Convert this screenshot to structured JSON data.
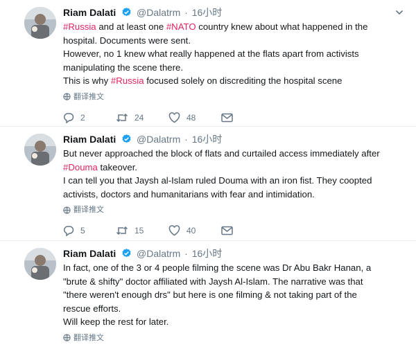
{
  "tweets": [
    {
      "author": "Riam Dalati",
      "handle": "@Dalatrm",
      "time": "16小时",
      "lines": [
        [
          "#Russia",
          " and at least one ",
          "#NATO",
          " country knew about what happened in the"
        ],
        [
          "hospital. Documents were sent."
        ],
        [
          "However, no 1 knew what really happened at the flats apart from activists"
        ],
        [
          "manipulating the scene there."
        ],
        [
          "This is why ",
          "#Russia",
          " focused solely on discrediting the hospital scene"
        ]
      ],
      "translate": "翻译推文",
      "replies": "2",
      "retweets": "24",
      "likes": "48"
    },
    {
      "author": "Riam Dalati",
      "handle": "@Dalatrm",
      "time": "16小时",
      "lines": [
        [
          "But never approached the block of flats and curtailed access immediately after"
        ],
        [
          "#Douma",
          " takeover."
        ],
        [
          "I can tell you that Jaysh al-Islam ruled Douma with an iron fist. They coopted"
        ],
        [
          "activists, doctors and humanitarians with fear and intimidation."
        ]
      ],
      "translate": "翻译推文",
      "replies": "5",
      "retweets": "15",
      "likes": "40"
    },
    {
      "author": "Riam Dalati",
      "handle": "@Dalatrm",
      "time": "16小时",
      "lines": [
        [
          "In fact, one of the 3 or 4 people filming the scene was Dr Abu Bakr Hanan, a"
        ],
        [
          "\"brute & shifty\" doctor affiliated with Jaysh Al-Islam. The narrative was that"
        ],
        [
          "\"there weren't enough drs\" but here is one filming & not taking part of the"
        ],
        [
          "rescue efforts."
        ],
        [
          "Will keep the rest for later."
        ]
      ],
      "translate": "翻译推文"
    }
  ],
  "colors": {
    "hashtag": "#e0245e",
    "link": "#1da1f2",
    "muted": "#657786",
    "verified": "#1da1f2"
  }
}
